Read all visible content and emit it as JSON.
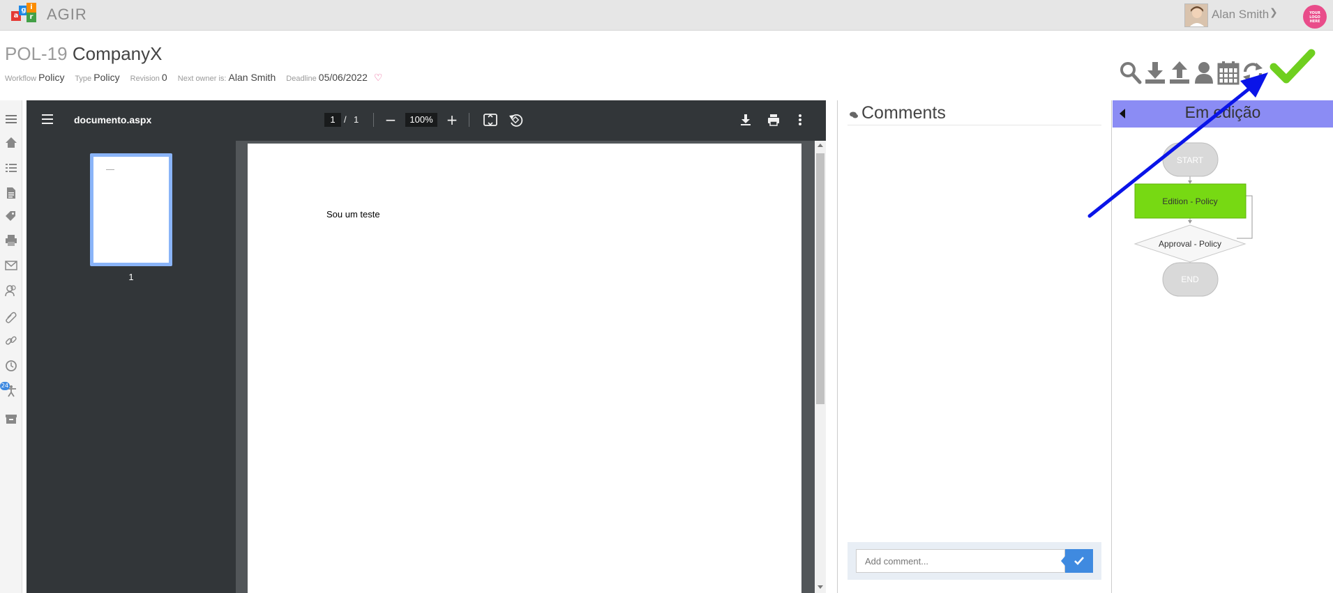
{
  "app": {
    "name": "AGIR",
    "logo_letters": [
      "a",
      "g",
      "i",
      "r"
    ],
    "user_name": "Alan Smith",
    "company_logo_text": [
      "YOUR",
      "LOGO",
      "HERE"
    ]
  },
  "document": {
    "code": "POL-19",
    "company": "CompanyX",
    "meta": {
      "workflow_label": "Workflow",
      "workflow_value": "Policy",
      "type_label": "Type",
      "type_value": "Policy",
      "revision_label": "Revision",
      "revision_value": "0",
      "next_owner_label": "Next owner is:",
      "next_owner_value": "Alan Smith",
      "deadline_label": "Deadline",
      "deadline_value": "05/06/2022"
    }
  },
  "toolbar": {
    "icons": [
      "search-icon",
      "download-icon",
      "upload-icon",
      "user-icon",
      "calendar-icon",
      "refresh-icon"
    ],
    "approve_icon": "check-icon",
    "approve_color": "#6fcf1f"
  },
  "sidebar": {
    "icons": [
      "menu-icon",
      "home-icon",
      "list-icon",
      "document-icon",
      "tags-icon",
      "print-icon",
      "mail-icon",
      "users-icon",
      "attachment-icon",
      "link-icon",
      "clock-icon",
      "accessibility-icon",
      "archive-icon"
    ],
    "badge": "24"
  },
  "viewer": {
    "filename": "documento.aspx",
    "page_current": "1",
    "page_separator": "/",
    "page_total": "1",
    "zoom": "100%",
    "thumb_label": "1",
    "page_text": "Sou um teste"
  },
  "comments": {
    "title": "Comments",
    "placeholder": "Add comment..."
  },
  "workflow": {
    "state": "Em edição",
    "nodes": {
      "start": "START",
      "edition": "Edition - Policy",
      "approval": "Approval - Policy",
      "end": "END"
    },
    "active_color": "#77d913",
    "header_color": "#8b8cf4"
  }
}
